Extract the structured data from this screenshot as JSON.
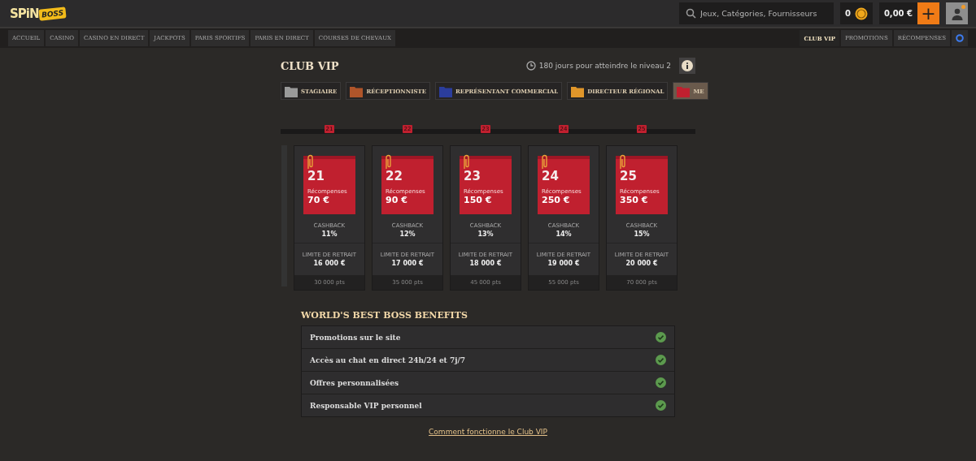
{
  "logo": {
    "word_1": "SPiN",
    "word_2": "BOSS"
  },
  "header": {
    "search": {
      "placeholder": "Jeux, Catégories, Fournisseurs"
    },
    "coins": "0",
    "balance": "0,00 €",
    "deposit_button": "+"
  },
  "main_nav": [
    {
      "label": "ACCUEIL",
      "selected": false
    },
    {
      "label": "CASINO",
      "selected": false
    },
    {
      "label": "CASINO EN DIRECT",
      "selected": false
    },
    {
      "label": "JACKPOTS",
      "selected": false
    },
    {
      "label": "PARIS SPORTIFS",
      "selected": false
    },
    {
      "label": "PARIS EN DIRECT",
      "selected": false
    },
    {
      "label": "COURSES DE CHEVAUX",
      "selected": false
    }
  ],
  "side_nav": [
    {
      "label": "CLUB VIP",
      "selected": true
    },
    {
      "label": "PROMOTIONS",
      "selected": false
    },
    {
      "label": "RÉCOMPENSES",
      "selected": false
    }
  ],
  "club": {
    "title": "CLUB VIP",
    "countdown": "180 jours pour atteindre le niveau 2"
  },
  "ranks": [
    {
      "label": "STAGIAIRE",
      "color": "#9a9a9a",
      "selected": false
    },
    {
      "label": "RÉCEPTIONNISTE",
      "color": "#b0552a",
      "selected": false
    },
    {
      "label": "REPRÉSENTANT COMMERCIAL",
      "color": "#2b3d9c",
      "selected": false
    },
    {
      "label": "DIRECTEUR RÉGIONAL",
      "color": "#e0962a",
      "selected": false
    },
    {
      "label": "ME",
      "color": "#c0202f",
      "selected": true
    }
  ],
  "levels": [
    {
      "marker": "21",
      "number": "21",
      "rewards_label": "Récompenses",
      "reward": "70 €",
      "cashback_label": "CASHBACK",
      "cashback": "11%",
      "limit_label": "LIMITE DE RETRAIT",
      "limit": "16 000 €",
      "points": "30 000 pts"
    },
    {
      "marker": "22",
      "number": "22",
      "rewards_label": "Récompenses",
      "reward": "90 €",
      "cashback_label": "CASHBACK",
      "cashback": "12%",
      "limit_label": "LIMITE DE RETRAIT",
      "limit": "17 000 €",
      "points": "35 000 pts"
    },
    {
      "marker": "23",
      "number": "23",
      "rewards_label": "Récompenses",
      "reward": "150 €",
      "cashback_label": "CASHBACK",
      "cashback": "13%",
      "limit_label": "LIMITE DE RETRAIT",
      "limit": "18 000 €",
      "points": "45 000 pts"
    },
    {
      "marker": "24",
      "number": "24",
      "rewards_label": "Récompenses",
      "reward": "250 €",
      "cashback_label": "CASHBACK",
      "cashback": "14%",
      "limit_label": "LIMITE DE RETRAIT",
      "limit": "19 000 €",
      "points": "55 000 pts"
    },
    {
      "marker": "25",
      "number": "25",
      "rewards_label": "Récompenses",
      "reward": "350 €",
      "cashback_label": "CASHBACK",
      "cashback": "15%",
      "limit_label": "LIMITE DE RETRAIT",
      "limit": "20 000 €",
      "points": "70 000 pts"
    }
  ],
  "benefits": {
    "title": "WORLD'S BEST BOSS BENEFITS",
    "items": [
      {
        "label": "Promotions sur le site",
        "checked": true
      },
      {
        "label": "Accès au chat en direct 24h/24 et 7j/7",
        "checked": true
      },
      {
        "label": "Offres personnalisées",
        "checked": true
      },
      {
        "label": "Responsable VIP personnel",
        "checked": true
      }
    ]
  },
  "help_link": "Comment fonctionne le Club VIP"
}
